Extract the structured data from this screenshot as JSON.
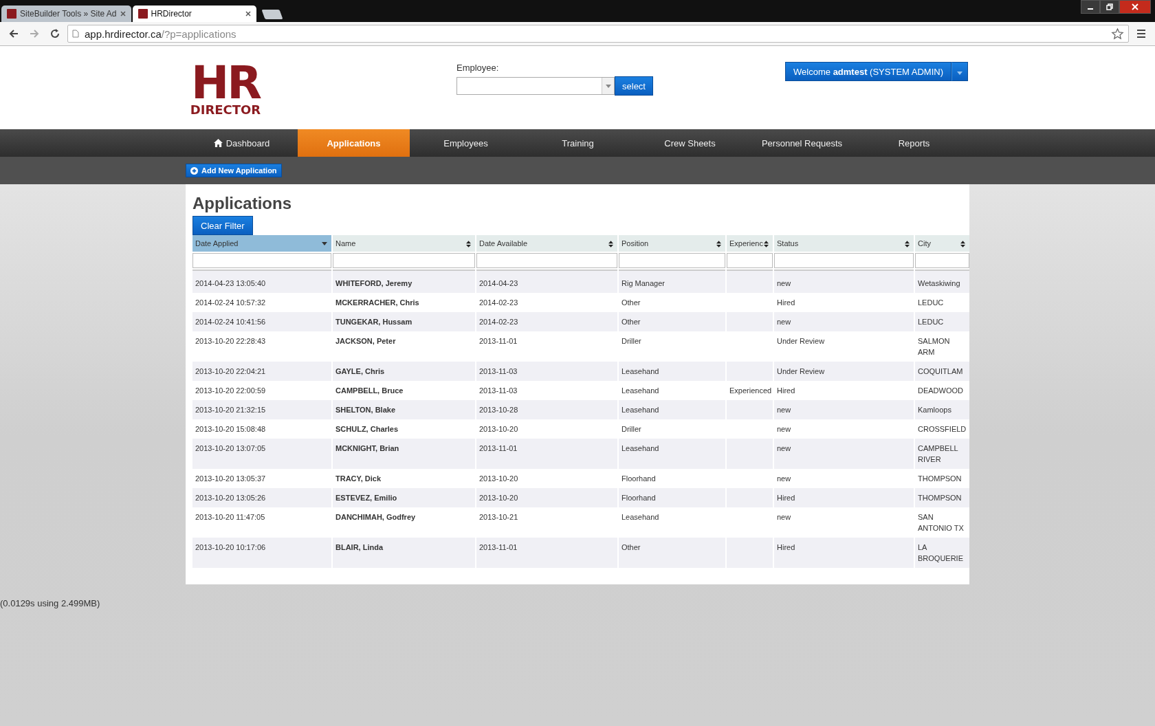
{
  "browser": {
    "tabs": [
      {
        "title": "SiteBuilder Tools » Site Ad",
        "selected": false
      },
      {
        "title": "HRDirector",
        "selected": true
      }
    ],
    "url_host": "app.hrdirector.ca",
    "url_path": "/?p=applications"
  },
  "logo": {
    "top": "HR",
    "bottom": "DIRECTOR"
  },
  "employee_picker": {
    "label": "Employee:",
    "button": "select"
  },
  "user_menu": {
    "prefix": "Welcome ",
    "user": "admtest",
    "suffix": " (SYSTEM ADMIN)"
  },
  "nav": [
    {
      "label": "Dashboard",
      "kind": "home",
      "selected": false
    },
    {
      "label": "Applications",
      "selected": true
    },
    {
      "label": "Employees",
      "selected": false
    },
    {
      "label": "Training",
      "selected": false
    },
    {
      "label": "Crew Sheets",
      "selected": false
    },
    {
      "label": "Personnel Requests",
      "selected": false
    },
    {
      "label": "Reports",
      "selected": false
    }
  ],
  "add_button": "Add New Application",
  "page_title": "Applications",
  "clear_filter": "Clear Filter",
  "table": {
    "columns": [
      {
        "label": "Date Applied",
        "selected": true
      },
      {
        "label": "Name",
        "selected": false
      },
      {
        "label": "Date Available",
        "selected": false
      },
      {
        "label": "Position",
        "selected": false
      },
      {
        "label": "Experienc",
        "selected": false
      },
      {
        "label": "Status",
        "selected": false
      },
      {
        "label": "City",
        "selected": false
      }
    ],
    "rows": [
      [
        "2014-04-23 13:05:40",
        "WHITEFORD, Jeremy",
        "2014-04-23",
        "Rig Manager",
        "",
        "new",
        "Wetaskiwing"
      ],
      [
        "2014-02-24 10:57:32",
        "MCKERRACHER, Chris",
        "2014-02-23",
        "Other",
        "",
        "Hired",
        "LEDUC"
      ],
      [
        "2014-02-24 10:41:56",
        "TUNGEKAR, Hussam",
        "2014-02-23",
        "Other",
        "",
        "new",
        "LEDUC"
      ],
      [
        "2013-10-20 22:28:43",
        "JACKSON, Peter",
        "2013-11-01",
        "Driller",
        "",
        "Under Review",
        "SALMON ARM"
      ],
      [
        "2013-10-20 22:04:21",
        "GAYLE, Chris",
        "2013-11-03",
        "Leasehand",
        "",
        "Under Review",
        "COQUITLAM"
      ],
      [
        "2013-10-20 22:00:59",
        "CAMPBELL, Bruce",
        "2013-11-03",
        "Leasehand",
        "Experienced",
        "Hired",
        "DEADWOOD"
      ],
      [
        "2013-10-20 21:32:15",
        "SHELTON, Blake",
        "2013-10-28",
        "Leasehand",
        "",
        "new",
        "Kamloops"
      ],
      [
        "2013-10-20 15:08:48",
        "SCHULZ, Charles",
        "2013-10-20",
        "Driller",
        "",
        "new",
        "CROSSFIELD"
      ],
      [
        "2013-10-20 13:07:05",
        "MCKNIGHT, Brian",
        "2013-11-01",
        "Leasehand",
        "",
        "new",
        "CAMPBELL RIVER"
      ],
      [
        "2013-10-20 13:05:37",
        "TRACY, Dick",
        "2013-10-20",
        "Floorhand",
        "",
        "new",
        "THOMPSON"
      ],
      [
        "2013-10-20 13:05:26",
        "ESTEVEZ, Emilio",
        "2013-10-20",
        "Floorhand",
        "",
        "Hired",
        "THOMPSON"
      ],
      [
        "2013-10-20 11:47:05",
        "DANCHIMAH, Godfrey",
        "2013-10-21",
        "Leasehand",
        "",
        "new",
        "SAN ANTONIO TX"
      ],
      [
        "2013-10-20 10:17:06",
        "BLAIR, Linda",
        "2013-11-01",
        "Other",
        "",
        "Hired",
        "LA BROQUERIE"
      ]
    ]
  },
  "footer": "(0.0129s using 2.499MB)"
}
